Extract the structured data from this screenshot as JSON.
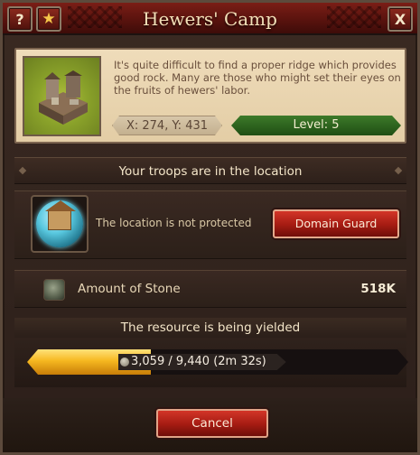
{
  "header": {
    "title": "Hewers' Camp",
    "help_label": "?",
    "favorite_label": "★",
    "close_label": "X"
  },
  "info": {
    "description": "It's quite difficult to find a proper ridge which provides good rock. Many are those who might set their eyes on the fruits of hewers' labor.",
    "coords": "X: 274, Y: 431",
    "level": "Level: 5"
  },
  "troops": {
    "label": "Your troops are in the location"
  },
  "protection": {
    "status": "The location is not protected",
    "button": "Domain Guard"
  },
  "resource": {
    "label": "Amount of Stone",
    "value": "518K"
  },
  "yield": {
    "title": "The resource is being yielded",
    "progress_text": "3,059 / 9,440 (2m 32s)",
    "current": 3059,
    "total": 9440
  },
  "footer": {
    "cancel": "Cancel"
  },
  "colors": {
    "accent_red": "#a41b12",
    "level_green": "#3d7a2a",
    "progress_gold": "#f6b820"
  },
  "icons": [
    "help-icon",
    "star-icon",
    "close-icon",
    "camp-image",
    "shield-dome-icon",
    "stone-icon",
    "coin-icon"
  ]
}
